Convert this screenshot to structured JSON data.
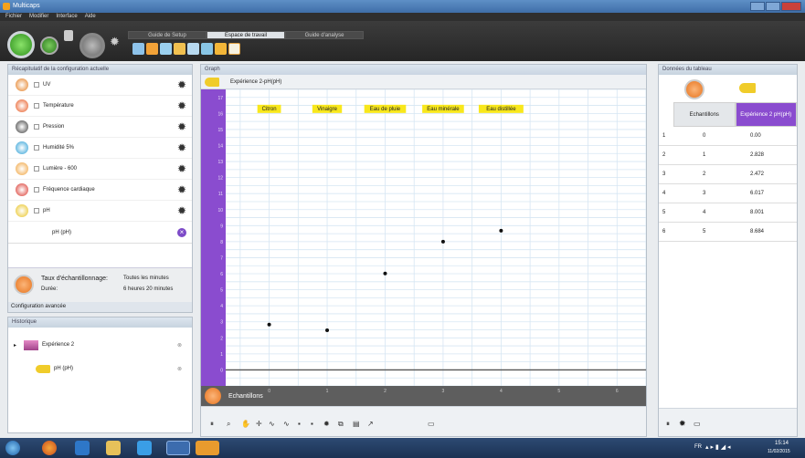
{
  "window": {
    "title": "Multicaps"
  },
  "menu": [
    "Fichier",
    "Modifier",
    "Interface",
    "Aide"
  ],
  "tabs": [
    "Guide de Setup",
    "Espace de travail",
    "Guide d'analyse"
  ],
  "active_tab": 1,
  "config_panel": {
    "title": "Récapitulatif de la configuration actuelle",
    "sensors": [
      {
        "label": "UV",
        "icon": "uv-sensor-icon",
        "color": "#e47b1c"
      },
      {
        "label": "Température",
        "icon": "temperature-sensor-icon",
        "color": "#e8561e"
      },
      {
        "label": "Pression",
        "icon": "pressure-sensor-icon",
        "color": "#3c3c3c"
      },
      {
        "label": "Humidité 5%",
        "icon": "humidity-sensor-icon",
        "color": "#2b9fd6"
      },
      {
        "label": "Lumière - 600",
        "icon": "light-sensor-icon",
        "color": "#f0a23a"
      },
      {
        "label": "Fréquence cardiaque",
        "icon": "heart-rate-sensor-icon",
        "color": "#d9342b"
      },
      {
        "label": "pH",
        "icon": "ph-sensor-icon",
        "color": "#e8c21e"
      }
    ],
    "selected_sub": "pH (pH)",
    "sampling_label": "Taux d'échantillonnage:",
    "sampling_value": "Toutes les minutes",
    "duration_label": "Durée:",
    "duration_value": "6 heures 20 minutes",
    "advanced": "Configuration avancée"
  },
  "history_panel": {
    "title": "Historique",
    "experiment": "Expérience 2",
    "sub": "pH (pH)"
  },
  "graph": {
    "title": "Graph",
    "series_label": "Expérience 2-pH(pH)",
    "x_axis_label": "Echantillons",
    "annotations": [
      "Citron",
      "Vinaigre",
      "Eau de pluie",
      "Eau minérale",
      "Eau distillée"
    ]
  },
  "chart_data": {
    "type": "scatter",
    "title": "",
    "xlabel": "Echantillons",
    "ylabel": "",
    "x_ticks": [
      0,
      1,
      2,
      3,
      4,
      5,
      6
    ],
    "y_ticks": [
      1,
      2,
      3,
      4,
      5,
      6,
      7,
      8,
      9,
      10,
      11,
      12,
      13,
      14,
      15,
      16,
      17
    ],
    "xlim": [
      -0.75,
      6.5
    ],
    "ylim": [
      -1,
      17.5
    ],
    "series": [
      {
        "points": [
          {
            "x": 0,
            "y": 2.828
          },
          {
            "x": 1,
            "y": 2.472
          },
          {
            "x": 2,
            "y": 6.017
          },
          {
            "x": 3,
            "y": 8.001
          },
          {
            "x": 4,
            "y": 8.684
          }
        ]
      }
    ],
    "annotations": [
      {
        "text": "Citron",
        "x": 0
      },
      {
        "text": "Vinaigre",
        "x": 1
      },
      {
        "text": "Eau de pluie",
        "x": 2
      },
      {
        "text": "Eau minérale",
        "x": 3
      },
      {
        "text": "Eau distillée",
        "x": 4
      }
    ],
    "grid": true
  },
  "table_panel": {
    "title": "Données du tableau",
    "col1": "Echantillons",
    "col2": "Expérience 2 pH(pH)",
    "accent": "#8a4ccf",
    "rows": [
      {
        "n": "1",
        "sample": "0",
        "value": "0.00"
      },
      {
        "n": "2",
        "sample": "1",
        "value": "2.828"
      },
      {
        "n": "3",
        "sample": "2",
        "value": "2.472"
      },
      {
        "n": "4",
        "sample": "3",
        "value": "6.017"
      },
      {
        "n": "5",
        "sample": "4",
        "value": "8.001"
      },
      {
        "n": "6",
        "sample": "5",
        "value": "8.684"
      }
    ]
  },
  "taskbar": {
    "lang": "FR",
    "time": "15:14",
    "date": "11/02/2015"
  }
}
